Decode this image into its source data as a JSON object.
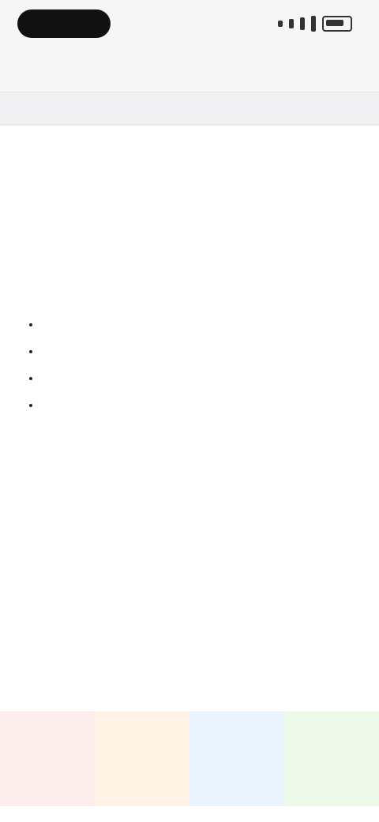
{
  "status": {
    "time": ""
  },
  "nav": {
    "left": "",
    "title": "",
    "right": ""
  },
  "tabs": {
    "left": "",
    "middle": "",
    "right": ""
  },
  "content": {
    "headline": "",
    "subheading": "",
    "list": [
      {
        "label": "",
        "text": ""
      },
      {
        "label": "",
        "text": ""
      },
      {
        "label": "",
        "text": ""
      },
      {
        "label": "",
        "text": ""
      }
    ],
    "footnote_label": "",
    "footnote_text": ""
  },
  "bottom_buttons": [
    {
      "label": ""
    },
    {
      "label": ""
    },
    {
      "label": ""
    },
    {
      "label": ""
    }
  ]
}
